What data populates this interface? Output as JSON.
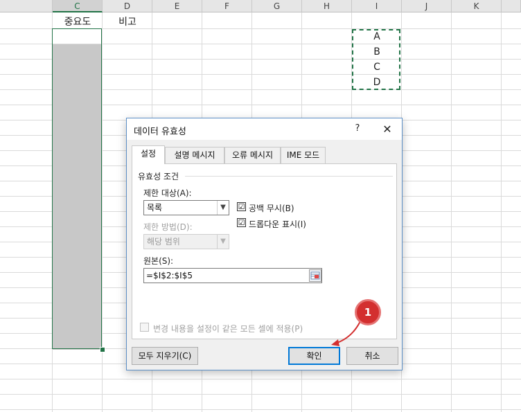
{
  "spreadsheet": {
    "column_headers": [
      "C",
      "D",
      "E",
      "F",
      "G",
      "H",
      "I",
      "J",
      "K"
    ],
    "selected_column": "C",
    "cells": {
      "c1": "중요도",
      "d1": "비고",
      "list": [
        "A",
        "B",
        "C",
        "D"
      ]
    }
  },
  "dialog": {
    "title": "데이터 유효성",
    "help_label": "?",
    "close_label": "✕",
    "tabs": [
      {
        "label": "설정"
      },
      {
        "label": "설명 메시지"
      },
      {
        "label": "오류 메시지"
      },
      {
        "label": "IME 모드"
      }
    ],
    "group_label": "유효성 조건",
    "allow_label": "제한 대상(A):",
    "allow_value": "목록",
    "data_label": "제한 방법(D):",
    "data_value": "해당 범위",
    "ignore_blank_label": "공백 무시(B)",
    "ignore_blank_checked": "☑",
    "dropdown_label": "드롭다운 표시(I)",
    "dropdown_checked": "☑",
    "source_label": "원본(S):",
    "source_value": "=$I$2:$I$5",
    "apply_all_label": "변경 내용을 설정이 같은 모든 셀에 적용(P)",
    "clear_all_label": "모두 지우기(C)",
    "ok_label": "확인",
    "cancel_label": "취소"
  },
  "annotation": {
    "step_number": "1",
    "color": "#d32f2f"
  },
  "colors": {
    "excel_green": "#217346",
    "accent_blue": "#0078d7"
  }
}
